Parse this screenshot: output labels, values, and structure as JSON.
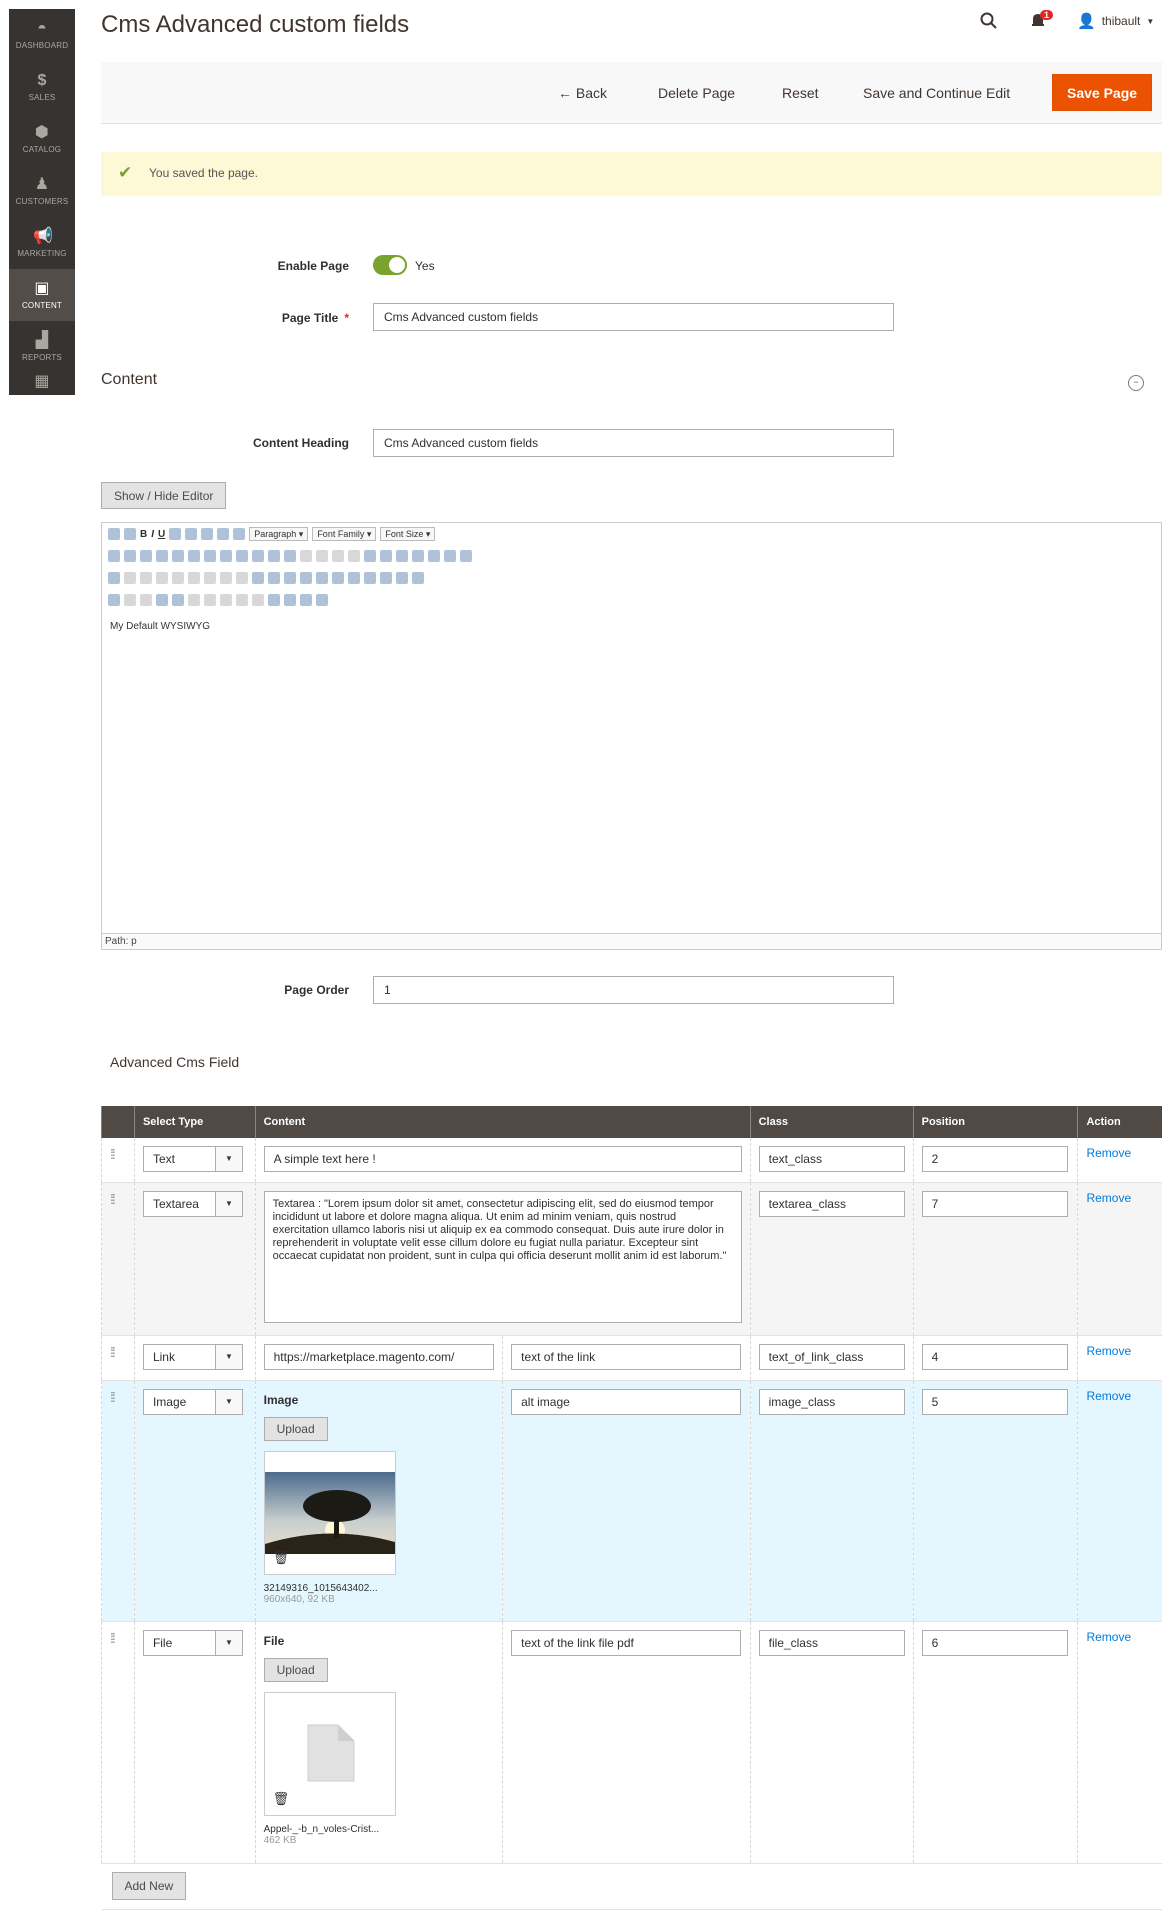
{
  "sidebar": {
    "items": [
      {
        "label": "DASHBOARD",
        "icon": "dashboard-icon"
      },
      {
        "label": "SALES",
        "icon": "dollar-icon"
      },
      {
        "label": "CATALOG",
        "icon": "box-icon"
      },
      {
        "label": "CUSTOMERS",
        "icon": "person-icon"
      },
      {
        "label": "MARKETING",
        "icon": "megaphone-icon"
      },
      {
        "label": "CONTENT",
        "icon": "layout-icon"
      },
      {
        "label": "REPORTS",
        "icon": "bar-chart-icon"
      },
      {
        "label": "",
        "icon": "store-icon"
      }
    ]
  },
  "header": {
    "title": "Cms Advanced custom fields",
    "notifications": "1",
    "user": "thibault"
  },
  "toolbar": {
    "back": "Back",
    "delete": "Delete Page",
    "reset": "Reset",
    "save_continue": "Save and Continue Edit",
    "save": "Save Page"
  },
  "message": "You saved the page.",
  "form": {
    "enable_label": "Enable Page",
    "enable_value": "Yes",
    "title_label": "Page Title",
    "title_value": "Cms Advanced custom fields",
    "content_section": "Content",
    "heading_label": "Content Heading",
    "heading_value": "Cms Advanced custom fields",
    "show_hide": "Show / Hide Editor",
    "editor_text": "My Default WYSIWYG",
    "editor_path": "Path: p",
    "order_label": "Page Order",
    "order_value": "1",
    "paragraph": "Paragraph",
    "font_family": "Font Family",
    "font_size": "Font Size"
  },
  "advanced": {
    "title": "Advanced Cms Field",
    "headers": {
      "type": "Select Type",
      "content": "Content",
      "class": "Class",
      "position": "Position",
      "action": "Action"
    },
    "rows": [
      {
        "type": "Text",
        "content": "A simple text here !",
        "class": "text_class",
        "position": "2",
        "action": "Remove"
      },
      {
        "type": "Textarea",
        "content": "Textarea : \"Lorem ipsum dolor sit amet, consectetur adipiscing elit, sed do eiusmod tempor incididunt ut labore et dolore magna aliqua. Ut enim ad minim veniam, quis nostrud exercitation ullamco laboris nisi ut aliquip ex ea commodo consequat. Duis aute irure dolor in reprehenderit in voluptate velit esse cillum dolore eu fugiat nulla pariatur. Excepteur sint occaecat cupidatat non proident, sunt in culpa qui officia deserunt mollit anim id est laborum.\"",
        "class": "textarea_class",
        "position": "7",
        "action": "Remove"
      },
      {
        "type": "Link",
        "content": "https://marketplace.magento.com/",
        "link_text": "text of the link",
        "class": "text_of_link_class",
        "position": "4",
        "action": "Remove"
      },
      {
        "type": "Image",
        "content_label": "Image",
        "upload": "Upload",
        "file_name": "32149316_1015643402...",
        "file_size": "960x640, 92 KB",
        "alt": "alt image",
        "class": "image_class",
        "position": "5",
        "action": "Remove"
      },
      {
        "type": "File",
        "content_label": "File",
        "upload": "Upload",
        "file_name": "Appel-_-b_n_voles-Crist...",
        "file_size": "462 KB",
        "link_text": "text of the link file pdf",
        "class": "file_class",
        "position": "6",
        "action": "Remove"
      }
    ],
    "add_new": "Add New"
  }
}
